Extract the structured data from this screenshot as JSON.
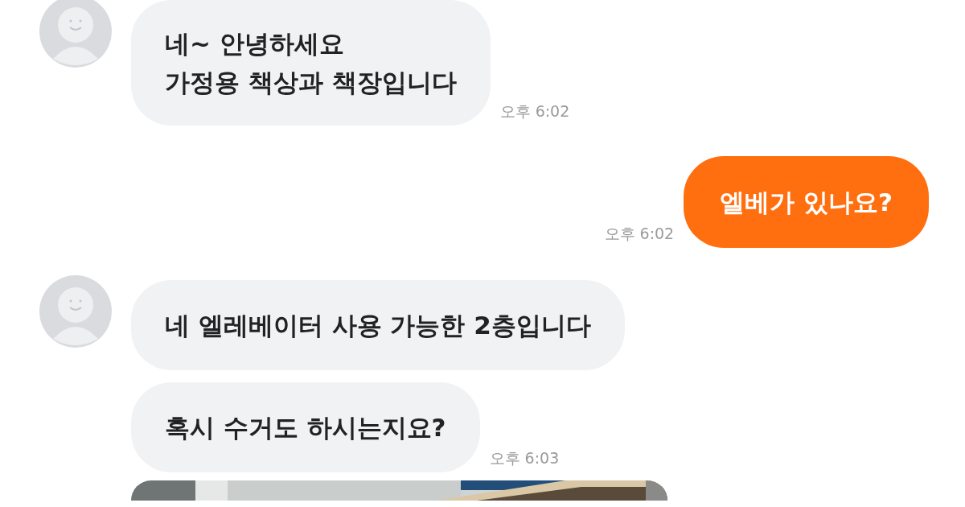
{
  "messages": [
    {
      "kind": "incoming",
      "avatar": true,
      "text": "네~ 안녕하세요\n가정용 책상과 책장입니다",
      "time": "오후 6:02"
    },
    {
      "kind": "outgoing",
      "text": "엘베가 있나요?",
      "time": "오후 6:02"
    },
    {
      "kind": "incoming",
      "avatar": true,
      "text": "네 엘레베이터 사용 가능한 2층입니다"
    },
    {
      "kind": "incoming",
      "avatar": false,
      "text": "혹시 수거도 하시는지요?",
      "time": "오후 6:03"
    },
    {
      "kind": "picture",
      "avatar": false
    }
  ]
}
